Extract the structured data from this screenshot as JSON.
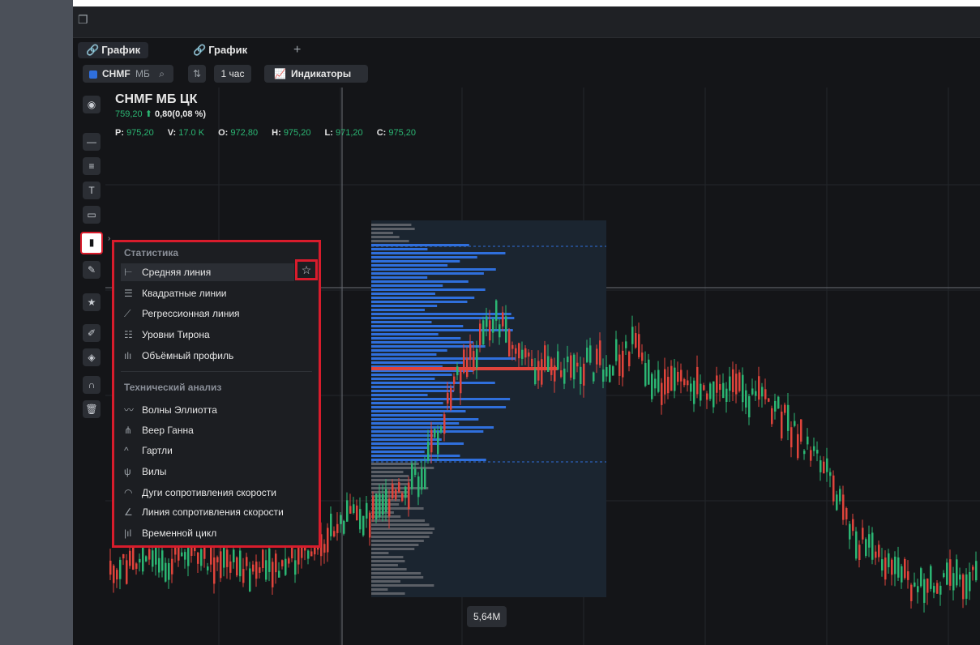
{
  "window": {
    "icon": "window-restore-icon"
  },
  "tabs": [
    {
      "label": "График",
      "icon": "link-icon"
    },
    {
      "label": "График",
      "icon": "link-icon"
    }
  ],
  "tab_add": "+",
  "toolbar": {
    "ticker_label": "CHMF",
    "ticker_exchange": "МБ",
    "interval": "1 час",
    "indicators": "Индикаторы"
  },
  "instrument": {
    "title": "CHMF МБ ЦК",
    "price": "759,20",
    "change": "0,80(0,08 %)",
    "ohlc": [
      {
        "k": "P:",
        "v": "975,20"
      },
      {
        "k": "V:",
        "v": "17.0 K"
      },
      {
        "k": "O:",
        "v": "972,80"
      },
      {
        "k": "H:",
        "v": "975,20"
      },
      {
        "k": "L:",
        "v": "971,20"
      },
      {
        "k": "C:",
        "v": "975,20"
      }
    ]
  },
  "menu": {
    "section1": "Статистика",
    "items1": [
      {
        "label": "Средняя линия",
        "icon": "horizontal-line-icon"
      },
      {
        "label": "Квадратные линии",
        "icon": "grid-lines-icon"
      },
      {
        "label": "Регрессионная линия",
        "icon": "regression-icon"
      },
      {
        "label": "Уровни Тирона",
        "icon": "levels-icon"
      },
      {
        "label": "Объёмный профиль",
        "icon": "volume-profile-icon"
      }
    ],
    "section2": "Технический анализ",
    "items2": [
      {
        "label": "Волны Эллиотта",
        "icon": "waves-icon"
      },
      {
        "label": "Веер Ганна",
        "icon": "fan-icon"
      },
      {
        "label": "Гартли",
        "icon": "chevron-up-icon"
      },
      {
        "label": "Вилы",
        "icon": "pitchfork-icon"
      },
      {
        "label": "Дуги сопротивления скорости",
        "icon": "arcs-icon"
      },
      {
        "label": "Линия сопротивления скорости",
        "icon": "speed-line-icon"
      },
      {
        "label": "Временной цикл",
        "icon": "time-cycle-icon"
      }
    ]
  },
  "volume_label": "5,64M",
  "colors": {
    "up": "#2bb673",
    "down": "#e0443b",
    "profile": "#2f6fdc",
    "highlight": "#d81c2c"
  }
}
